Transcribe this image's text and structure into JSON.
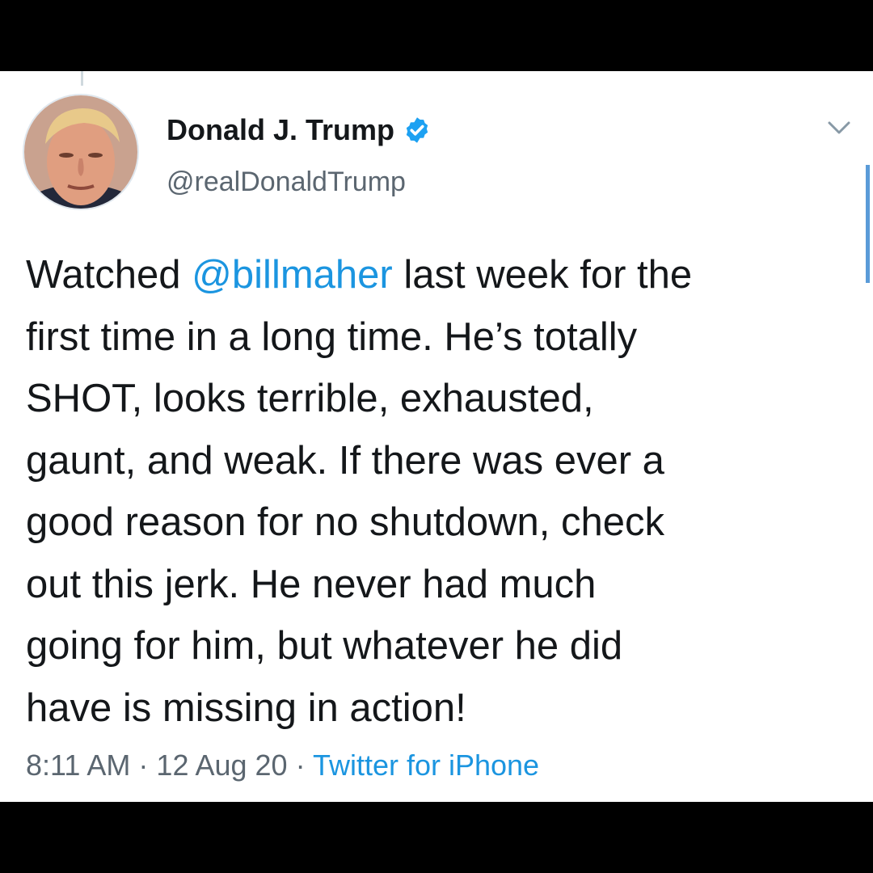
{
  "tweet": {
    "author": {
      "display_name": "Donald J. Trump",
      "handle": "@realDonaldTrump",
      "verified": true
    },
    "text_lines": [
      {
        "before": "Watched ",
        "mention": "@billmaher",
        "after": " last week for the"
      },
      {
        "text": "first time in a long time. He’s totally"
      },
      {
        "text": "SHOT, looks terrible, exhausted,"
      },
      {
        "text": "gaunt, and weak. If there was ever a"
      },
      {
        "text": "good reason for no shutdown, check"
      },
      {
        "text": "out this jerk. He never had much"
      },
      {
        "text": "going for him, but whatever he did"
      },
      {
        "text": "have is missing in action!"
      }
    ],
    "time": "8:11 AM",
    "date": "12 Aug 20",
    "separator": " · ",
    "source": "Twitter for iPhone"
  },
  "icons": {
    "verified": "verified-badge-icon",
    "menu": "chevron-down-icon"
  },
  "colors": {
    "link": "#1b95e0",
    "text": "#14171a",
    "secondary": "#5b6670",
    "background": "#ffffff",
    "frame": "#000000"
  }
}
